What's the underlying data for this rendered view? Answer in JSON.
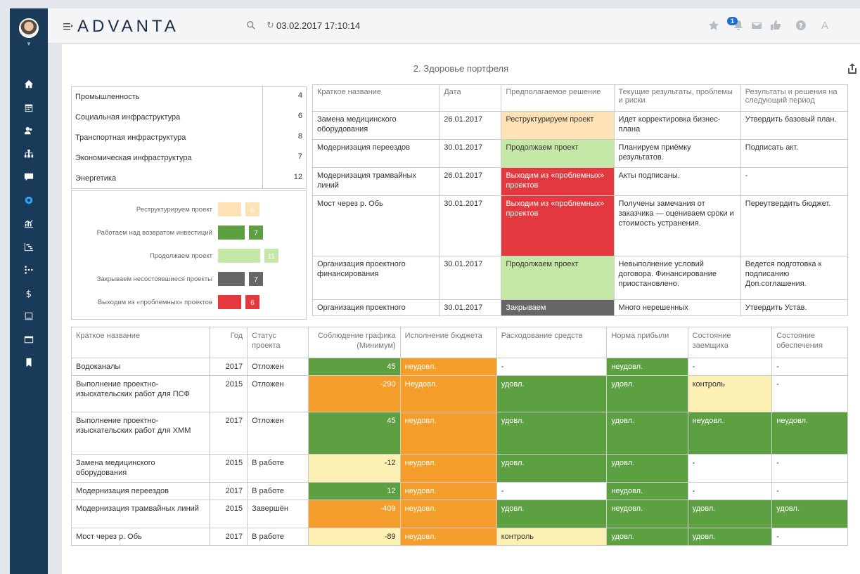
{
  "app": {
    "logo": "ADVANTA",
    "datetime": "03.02.2017 17:10:14",
    "notifications_badge": "1"
  },
  "page": {
    "title": "2. Здоровье портфеля"
  },
  "categories": [
    {
      "name": "Промышленность",
      "count": "4"
    },
    {
      "name": "Социальная инфраструктура",
      "count": "6"
    },
    {
      "name": "Транспортная инфраструктура",
      "count": "8"
    },
    {
      "name": "Экономическая инфраструктура",
      "count": "7"
    },
    {
      "name": "Энергетика",
      "count": "12"
    }
  ],
  "chart_data": {
    "type": "bar",
    "categories": [
      "Реструктурируем проект",
      "Работаем над возвратом инвестиций",
      "Продолжаем проект",
      "Закрываем несостоявшиеся проекты",
      "Выходим из «проблемных» проектов"
    ],
    "values": [
      6,
      7,
      11,
      7,
      6
    ],
    "colors": [
      "#fde2b5",
      "#5ca042",
      "#c6e8a6",
      "#666666",
      "#e3383d"
    ],
    "orientation": "horizontal",
    "value_labels_inside_boxes": true
  },
  "decisions_table": {
    "headers": [
      "Краткое название",
      "Дата",
      "Предполагаемое решение",
      "Текущие результаты, проблемы и риски",
      "Результаты и решения на следующий период"
    ],
    "rows": [
      {
        "name": "Замена медицинского оборудования",
        "date": "26.01.2017",
        "decision": "Реструктурируем проект",
        "decision_color": "pk",
        "results": "Идет корректировка бизнес-плана",
        "next": "Утвердить базовый план."
      },
      {
        "name": "Модернизация переездов",
        "date": "30.01.2017",
        "decision": "Продолжаем проект",
        "decision_color": "lg",
        "results": "Планируем приёмку результатов.",
        "next": "Подписать акт."
      },
      {
        "name": "Модернизация трамвайных линий",
        "date": "26.01.2017",
        "decision": "Выходим из «проблемных» проектов",
        "decision_color": "rd",
        "results": "Акты подписаны.",
        "next": "-"
      },
      {
        "name": "Мост через р. Обь",
        "date": "30.01.2017",
        "decision": "Выходим из «проблемных» проектов",
        "decision_color": "rd",
        "results": "Получены замечания от заказчика — оцениваем сроки и стоимость устранения.",
        "next": "Переутвердить бюджет."
      },
      {
        "name": "Организация проектного финансирования",
        "date": "30.01.2017",
        "decision": "Продолжаем проект",
        "decision_color": "lg",
        "results": "Невыполнение условий договора. Финансирование приостановлено.",
        "next": "Ведется подготовка к подписанию Доп.соглашения."
      },
      {
        "name": "Организация проектного",
        "date": "30.01.2017",
        "decision": "Закрываем",
        "decision_color": "dk",
        "results": "Много нерешенных",
        "next": "Утвердить Устав."
      }
    ]
  },
  "status_table": {
    "headers": [
      "Краткое название",
      "Год",
      "Статус проекта",
      "Соблюдение графика (Минимум)",
      "Исполнение бюджета",
      "Расходование средств",
      "Норма прибыли",
      "Состояние заемщика",
      "Состояние обеспечения"
    ],
    "rows": [
      {
        "name": "Водоканалы",
        "year": "2017",
        "status": "Отложен",
        "schedule": "45",
        "schedule_c": "g",
        "budget": "неудовл.",
        "budget_c": "o",
        "spend": "-",
        "spend_c": "",
        "profit": "неудовл.",
        "profit_c": "g",
        "borrower": "-",
        "borrower_c": "",
        "collateral": "-",
        "collateral_c": ""
      },
      {
        "name": "Выполнение проектно-изыскательских работ для ПСФ",
        "year": "2015",
        "status": "Отложен",
        "schedule": "-290",
        "schedule_c": "o",
        "budget": "Неудовл.",
        "budget_c": "o",
        "spend": "удовл.",
        "spend_c": "g",
        "profit": "удовл.",
        "profit_c": "g",
        "borrower": "контроль",
        "borrower_c": "y",
        "collateral": "-",
        "collateral_c": ""
      },
      {
        "name": "Выполнение проектно-изыскательских работ для ХММ",
        "year": "2017",
        "status": "Отложен",
        "schedule": "45",
        "schedule_c": "g",
        "budget": "неудовл.",
        "budget_c": "o",
        "spend": "удовл.",
        "spend_c": "g",
        "profit": "удовл.",
        "profit_c": "g",
        "borrower": "неудовл.",
        "borrower_c": "g",
        "collateral": "неудовл.",
        "collateral_c": "g"
      },
      {
        "name": "Замена медицинского оборудования",
        "year": "2015",
        "status": "В работе",
        "schedule": "-12",
        "schedule_c": "y",
        "budget": "неудовл.",
        "budget_c": "o",
        "spend": "удовл.",
        "spend_c": "g",
        "profit": "удовл.",
        "profit_c": "g",
        "borrower": "-",
        "borrower_c": "",
        "collateral": "-",
        "collateral_c": ""
      },
      {
        "name": "Модернизация переездов",
        "year": "2017",
        "status": "В работе",
        "schedule": "12",
        "schedule_c": "g",
        "budget": "неудовл.",
        "budget_c": "o",
        "spend": "-",
        "spend_c": "",
        "profit": "неудовл.",
        "profit_c": "g",
        "borrower": "-",
        "borrower_c": "",
        "collateral": "-",
        "collateral_c": ""
      },
      {
        "name": "Модернизация трамвайных линий",
        "year": "2015",
        "status": "Завершён",
        "schedule": "-409",
        "schedule_c": "o",
        "budget": "неудовл.",
        "budget_c": "o",
        "spend": "удовл.",
        "spend_c": "g",
        "profit": "неудовл.",
        "profit_c": "g",
        "borrower": "удовл.",
        "borrower_c": "g",
        "collateral": "удовл.",
        "collateral_c": "g"
      },
      {
        "name": "Мост через р. Обь",
        "year": "2017",
        "status": "В работе",
        "schedule": "-89",
        "schedule_c": "y",
        "budget": "неудовл.",
        "budget_c": "o",
        "spend": "контроль",
        "spend_c": "y",
        "profit": "удовл.",
        "profit_c": "g",
        "borrower": "удовл.",
        "borrower_c": "g",
        "collateral": "-",
        "collateral_c": ""
      }
    ]
  }
}
